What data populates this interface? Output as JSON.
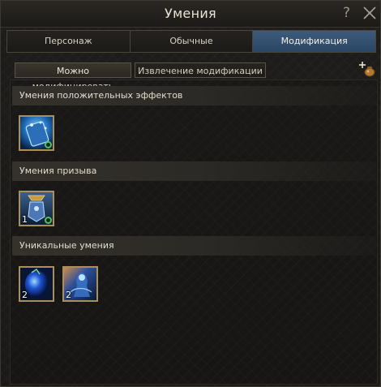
{
  "window": {
    "title": "Умения"
  },
  "main_tabs": [
    {
      "label": "Персонаж",
      "active": false
    },
    {
      "label": "Обычные",
      "active": false
    },
    {
      "label": "Модификация",
      "active": true
    }
  ],
  "sub_tabs": [
    {
      "label": "Можно модифицировать",
      "active": true
    },
    {
      "label": "Извлечение модификации",
      "active": false
    }
  ],
  "sections": [
    {
      "title": "Умения положительных эффектов",
      "skills": [
        {
          "icon": "buff-skill-icon",
          "count": ""
        }
      ]
    },
    {
      "title": "Умения призыва",
      "skills": [
        {
          "icon": "summon-skill-icon",
          "count": "1"
        }
      ]
    },
    {
      "title": "Уникальные умения",
      "skills": [
        {
          "icon": "unique-skill-orb-icon",
          "count": "2"
        },
        {
          "icon": "unique-skill-figure-icon",
          "count": "2"
        }
      ]
    }
  ],
  "colors": {
    "active_tab": "#2f4d6f",
    "skill_border": "#a98f5a",
    "modified_mark": "#54c25b"
  }
}
